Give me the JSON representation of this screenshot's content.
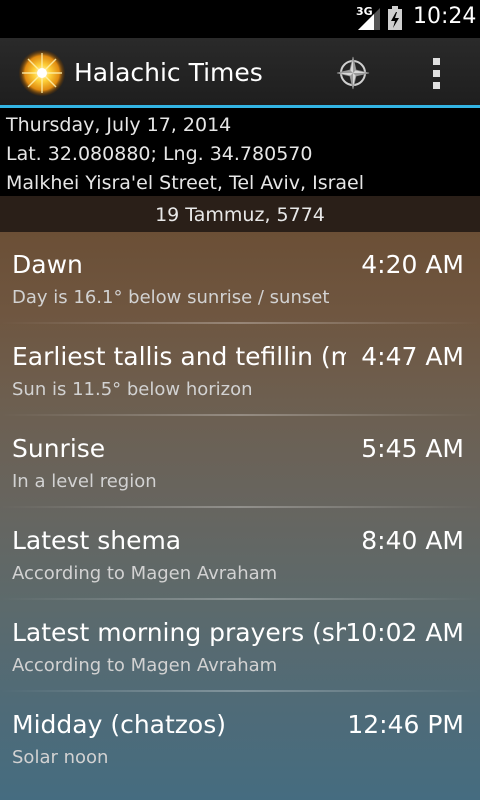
{
  "status_bar": {
    "network_type": "3G",
    "clock": "10:24"
  },
  "action_bar": {
    "title": "Halachic Times",
    "accent_color": "#33b5e5",
    "icons": [
      "sun-logo-icon",
      "compass-icon",
      "overflow-menu-icon"
    ]
  },
  "header": {
    "date": "Thursday, July 17, 2014",
    "coordinates": "Lat. 32.080880; Lng. 34.780570",
    "address": "Malkhei Yisra'el Street, Tel Aviv, Israel",
    "hebrew_date": "19 Tammuz, 5774"
  },
  "times": [
    {
      "name": "Dawn",
      "time": "4:20 AM",
      "description": "Day is 16.1° below sunrise / sunset"
    },
    {
      "name": "Earliest tallis and tefillin (misheyakir)",
      "time": "4:47 AM",
      "description": "Sun is 11.5° below horizon"
    },
    {
      "name": "Sunrise",
      "time": "5:45 AM",
      "description": "In a level region"
    },
    {
      "name": "Latest shema",
      "time": "8:40 AM",
      "description": "According to Magen Avraham"
    },
    {
      "name": "Latest morning prayers (shacharis)",
      "time": "10:02 AM",
      "description": "According to Magen Avraham"
    },
    {
      "name": "Midday (chatzos)",
      "time": "12:46 PM",
      "description": "Solar noon"
    }
  ]
}
